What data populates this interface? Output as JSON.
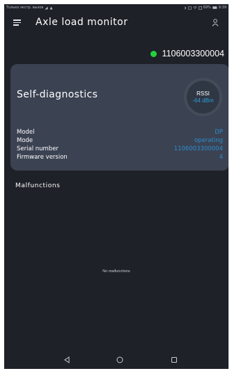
{
  "status_bar": {
    "left_text": "Только экстр. вызов",
    "right_text": "69%",
    "time": "9:39"
  },
  "app_bar": {
    "title": "Axle load monitor",
    "menu_icon": "hamburger-icon",
    "user_icon": "user-icon"
  },
  "device": {
    "id": "1106003300004",
    "online_color": "#22d23c"
  },
  "diagnostics": {
    "title": "Self-diagnostics",
    "rssi_label": "RSSI",
    "rssi_value": "-64 dBm",
    "rows": [
      {
        "label": "Model",
        "value": "DP"
      },
      {
        "label": "Mode",
        "value": "operating"
      },
      {
        "label": "Serial number",
        "value": "1106003300004"
      },
      {
        "label": "Firmware version",
        "value": "4"
      }
    ]
  },
  "malfunctions": {
    "title": "Malfunctions",
    "empty_text": "No malfunctions"
  },
  "nav": {
    "back_icon": "back-triangle-icon",
    "home_icon": "home-circle-icon",
    "recents_icon": "recents-square-icon"
  },
  "colors": {
    "background": "#1e2128",
    "card": "#3b4252",
    "accent": "#2a8fcf"
  }
}
